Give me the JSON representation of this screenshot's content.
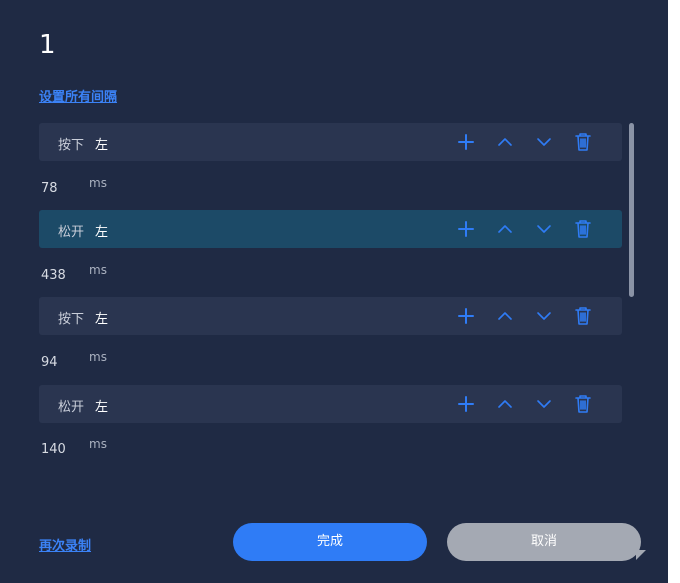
{
  "dialog": {
    "title": "1",
    "set_all_intervals_label": "设置所有间隔",
    "rerecord_label": "再次录制",
    "done_label": "完成",
    "cancel_label": "取消"
  },
  "events": [
    {
      "action": "按下",
      "key": "左",
      "delay": "78",
      "unit": "ms",
      "selected": false
    },
    {
      "action": "松开",
      "key": "左",
      "delay": "438",
      "unit": "ms",
      "selected": true
    },
    {
      "action": "按下",
      "key": "左",
      "delay": "94",
      "unit": "ms",
      "selected": false
    },
    {
      "action": "松开",
      "key": "左",
      "delay": "140",
      "unit": "ms",
      "selected": false
    }
  ],
  "icons": {
    "add": "plus-icon",
    "move_up": "chevron-up-icon",
    "move_down": "chevron-down-icon",
    "delete": "trash-icon"
  },
  "colors": {
    "background": "#1f2a44",
    "row": "#2a3550",
    "row_selected": "#1c4a67",
    "accent": "#2f7cf6",
    "link": "#3b82f6",
    "cancel": "#a4a9b3"
  }
}
